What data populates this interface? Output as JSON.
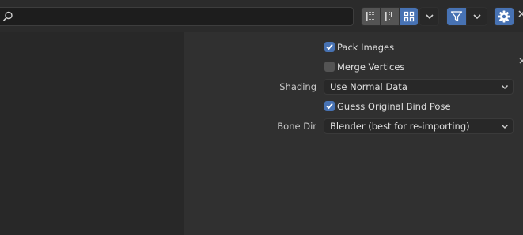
{
  "toolbar": {
    "search": {
      "value": "",
      "placeholder": ""
    },
    "icons": {
      "search": "search-icon",
      "list_view": "list-view-icon",
      "vertical_list": "vertical-list-icon",
      "thumbnail_view": "thumbnail-grid-icon",
      "display_dropdown": "chevron-down-icon",
      "filter": "filter-icon",
      "filter_dropdown": "chevron-down-icon",
      "settings": "gear-icon"
    },
    "active_view": "thumbnail"
  },
  "options": {
    "pack_images": {
      "label": "Pack Images",
      "checked": true
    },
    "merge_vertices": {
      "label": "Merge Vertices",
      "checked": false
    },
    "shading": {
      "label": "Shading",
      "value": "Use Normal Data"
    },
    "guess_bind_pose": {
      "label": "Guess Original Bind Pose",
      "checked": true
    },
    "bone_dir": {
      "label": "Bone Dir",
      "value": "Blender (best for re-importing)"
    }
  },
  "colors": {
    "accent": "#4772b3",
    "background": "#232323",
    "panel": "#303030",
    "text": "#e0e0e0"
  }
}
